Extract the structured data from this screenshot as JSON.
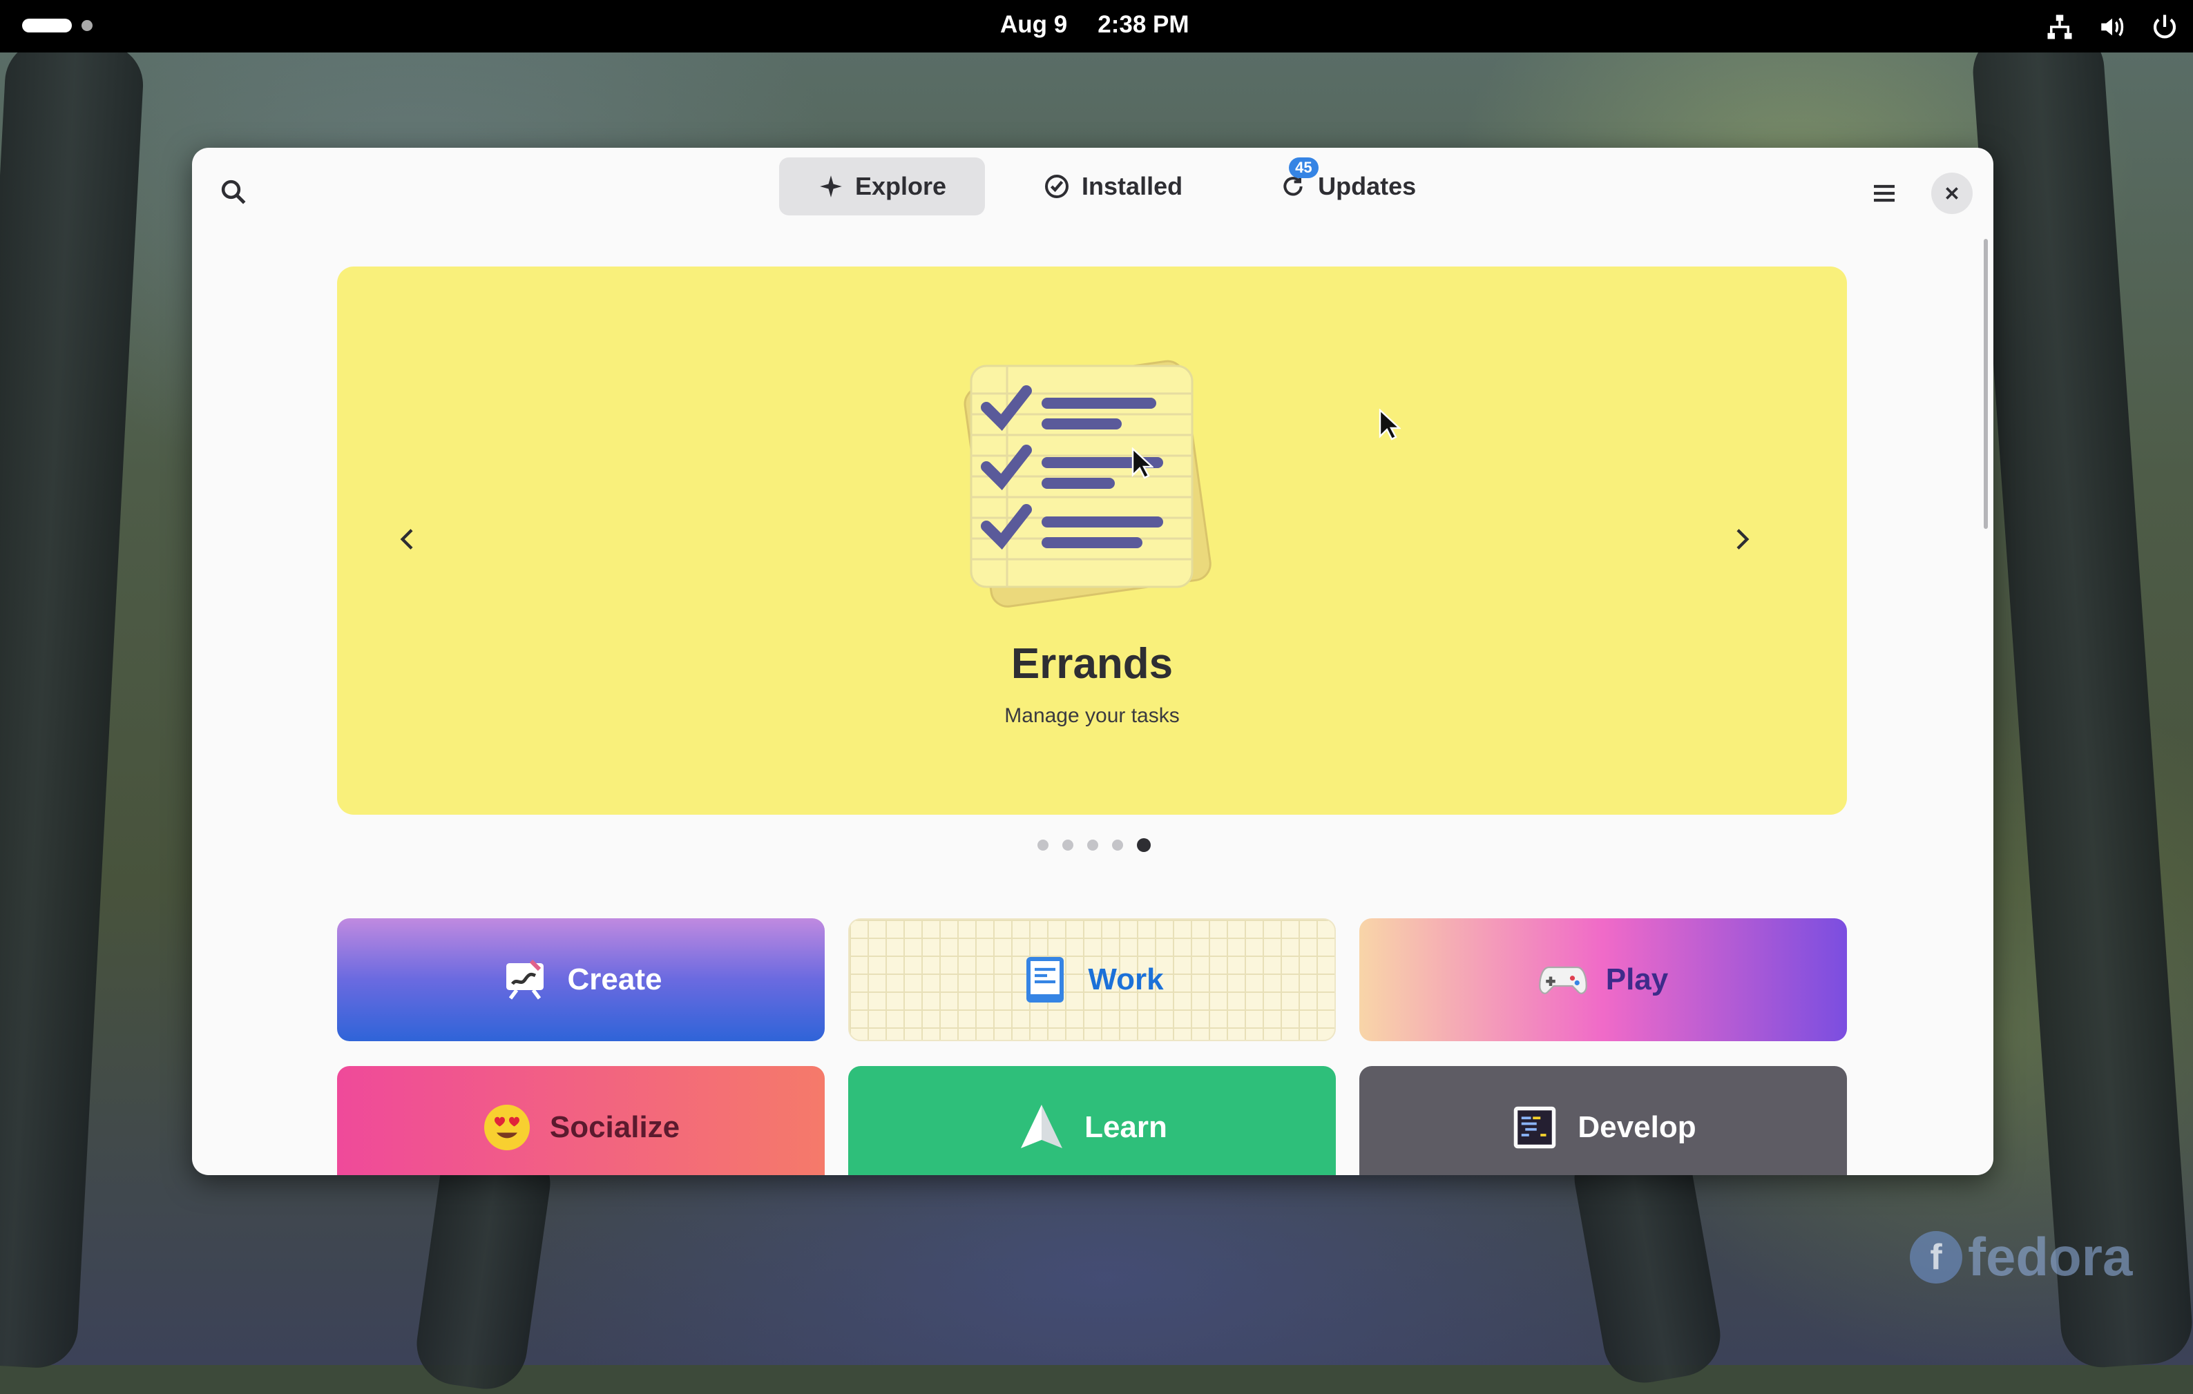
{
  "topbar": {
    "date": "Aug 9",
    "time": "2:38 PM"
  },
  "header": {
    "tabs": [
      {
        "label": "Explore",
        "icon": "sparkle-icon",
        "active": true
      },
      {
        "label": "Installed",
        "icon": "check-circle-icon",
        "active": false
      },
      {
        "label": "Updates",
        "icon": "refresh-icon",
        "active": false,
        "badge": "45"
      }
    ]
  },
  "carousel": {
    "title": "Errands",
    "subtitle": "Manage your tasks",
    "background": "#f9f07b",
    "page_count": 5,
    "current_page": 5
  },
  "categories": [
    {
      "label": "Create",
      "icon": "easel-icon"
    },
    {
      "label": "Work",
      "icon": "document-icon"
    },
    {
      "label": "Play",
      "icon": "gamepad-icon"
    },
    {
      "label": "Socialize",
      "icon": "heart-eyes-emoji-icon"
    },
    {
      "label": "Learn",
      "icon": "paper-plane-icon"
    },
    {
      "label": "Develop",
      "icon": "code-editor-icon"
    }
  ],
  "wallpaper": {
    "logo_text": "fedora"
  },
  "colors": {
    "accent": "#3584e4",
    "badge": "#3584e4"
  }
}
